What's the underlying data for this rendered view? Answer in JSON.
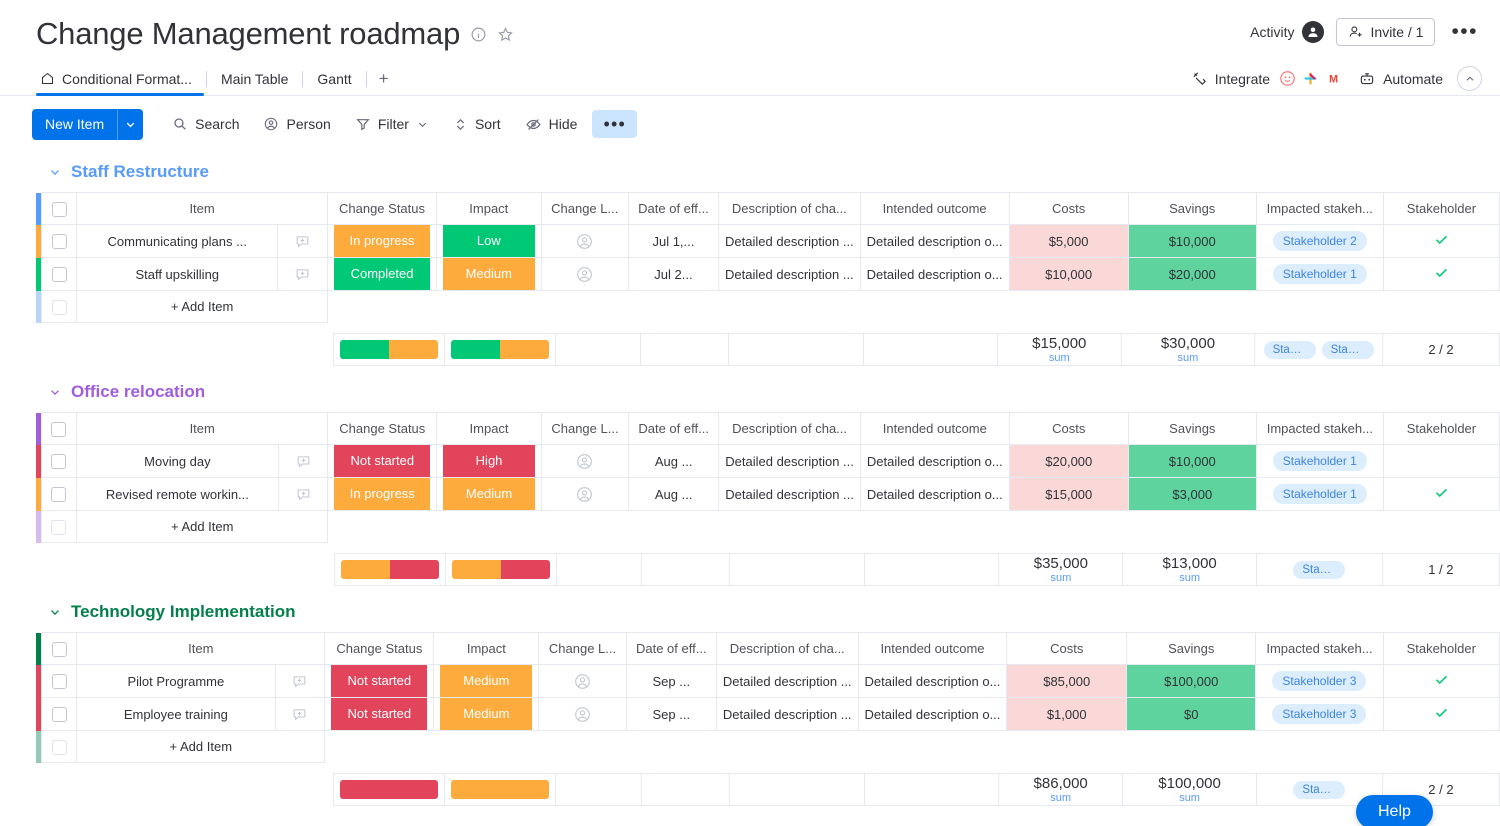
{
  "header": {
    "title": "Change Management roadmap",
    "info_icon": "info-icon",
    "star_icon": "star-icon",
    "activity_label": "Activity",
    "invite_label": "Invite / 1",
    "more_label": "•••"
  },
  "tabs": {
    "items": [
      {
        "label": "Conditional Format...",
        "icon": "home-icon",
        "active": true
      },
      {
        "label": "Main Table",
        "active": false
      },
      {
        "label": "Gantt",
        "active": false
      }
    ],
    "add_label": "+",
    "integrate_label": "Integrate",
    "automate_label": "Automate",
    "integration_icons": [
      "monday-icon",
      "slack-icon",
      "gmail-icon"
    ],
    "collapse_icon": "chevron-up-icon"
  },
  "toolbar": {
    "new_item_label": "New Item",
    "new_item_caret": "chevron-down-icon",
    "search_label": "Search",
    "person_label": "Person",
    "filter_label": "Filter",
    "sort_label": "Sort",
    "hide_label": "Hide",
    "more_label": "•••"
  },
  "columns": [
    "Item",
    "Change Status",
    "Impact",
    "Change L...",
    "Date of eff...",
    "Description of cha...",
    "Intended outcome",
    "Costs",
    "Savings",
    "Impacted stakeh...",
    "Stakeholder"
  ],
  "add_item_label": "+ Add Item",
  "sum_label": "sum",
  "colors": {
    "orange": "#fdab3d",
    "green": "#00c875",
    "red": "#e2445c",
    "blue": "#579bfc",
    "purple": "#a25ddc",
    "dark_green": "#037f4c",
    "accent": "#0073ea",
    "cost_bg": "#fbd8d8",
    "savings_bg": "#5ed39e",
    "chip_bg": "#dcedfe"
  },
  "groups": [
    {
      "name": "Staff Restructure",
      "color": "#579bfc",
      "title_color": "#579bfc",
      "rows": [
        {
          "item": "Communicating plans ...",
          "status": "In progress",
          "status_color": "#fdab3d",
          "impact": "Low",
          "impact_color": "#00c875",
          "date": "Jul 1,...",
          "description": "Detailed description ...",
          "outcome": "Detailed description o...",
          "costs": "$5,000",
          "savings": "$10,000",
          "stakeholder": "Stakeholder 2",
          "stakeholder_ok": true
        },
        {
          "item": "Staff upskilling",
          "status": "Completed",
          "status_color": "#00c875",
          "impact": "Medium",
          "impact_color": "#fdab3d",
          "date": "Jul 2...",
          "description": "Detailed description ...",
          "outcome": "Detailed description o...",
          "costs": "$10,000",
          "savings": "$20,000",
          "stakeholder": "Stakeholder 1",
          "stakeholder_ok": true
        }
      ],
      "summary": {
        "status_battery": [
          {
            "color": "#00c875",
            "pct": 50
          },
          {
            "color": "#fdab3d",
            "pct": 50
          }
        ],
        "impact_battery": [
          {
            "color": "#00c875",
            "pct": 50
          },
          {
            "color": "#fdab3d",
            "pct": 50
          }
        ],
        "costs": "$15,000",
        "savings": "$30,000",
        "stakeholders": [
          "Stake...",
          "Stake..."
        ],
        "ratio": "2 / 2"
      }
    },
    {
      "name": "Office relocation",
      "color": "#a25ddc",
      "title_color": "#a25ddc",
      "rows": [
        {
          "item": "Moving day",
          "status": "Not started",
          "status_color": "#e2445c",
          "impact": "High",
          "impact_color": "#e2445c",
          "date": "Aug ...",
          "description": "Detailed description ...",
          "outcome": "Detailed description o...",
          "costs": "$20,000",
          "savings": "$10,000",
          "stakeholder": "Stakeholder 1",
          "stakeholder_ok": false
        },
        {
          "item": "Revised remote workin...",
          "status": "In progress",
          "status_color": "#fdab3d",
          "impact": "Medium",
          "impact_color": "#fdab3d",
          "date": "Aug ...",
          "description": "Detailed description ...",
          "outcome": "Detailed description o...",
          "costs": "$15,000",
          "savings": "$3,000",
          "stakeholder": "Stakeholder 1",
          "stakeholder_ok": true
        }
      ],
      "summary": {
        "status_battery": [
          {
            "color": "#fdab3d",
            "pct": 50
          },
          {
            "color": "#e2445c",
            "pct": 50
          }
        ],
        "impact_battery": [
          {
            "color": "#fdab3d",
            "pct": 50
          },
          {
            "color": "#e2445c",
            "pct": 50
          }
        ],
        "costs": "$35,000",
        "savings": "$13,000",
        "stakeholders": [
          "Stakeholder 1"
        ],
        "ratio": "1 / 2"
      }
    },
    {
      "name": "Technology Implementation",
      "color": "#037f4c",
      "title_color": "#037f4c",
      "rows": [
        {
          "item": "Pilot Programme",
          "status": "Not started",
          "status_color": "#e2445c",
          "impact": "Medium",
          "impact_color": "#fdab3d",
          "date": "Sep ...",
          "description": "Detailed description ...",
          "outcome": "Detailed description o...",
          "costs": "$85,000",
          "savings": "$100,000",
          "stakeholder": "Stakeholder 3",
          "stakeholder_ok": true
        },
        {
          "item": "Employee training",
          "status": "Not started",
          "status_color": "#e2445c",
          "impact": "Medium",
          "impact_color": "#fdab3d",
          "date": "Sep ...",
          "description": "Detailed description ...",
          "outcome": "Detailed description o...",
          "costs": "$1,000",
          "savings": "$0",
          "stakeholder": "Stakeholder 3",
          "stakeholder_ok": true
        }
      ],
      "summary": {
        "status_battery": [
          {
            "color": "#e2445c",
            "pct": 100
          }
        ],
        "impact_battery": [
          {
            "color": "#fdab3d",
            "pct": 100
          }
        ],
        "costs": "$86,000",
        "savings": "$100,000",
        "stakeholders": [
          "Stakeh..."
        ],
        "ratio": "2 / 2"
      }
    }
  ],
  "help": {
    "label": "Help"
  }
}
